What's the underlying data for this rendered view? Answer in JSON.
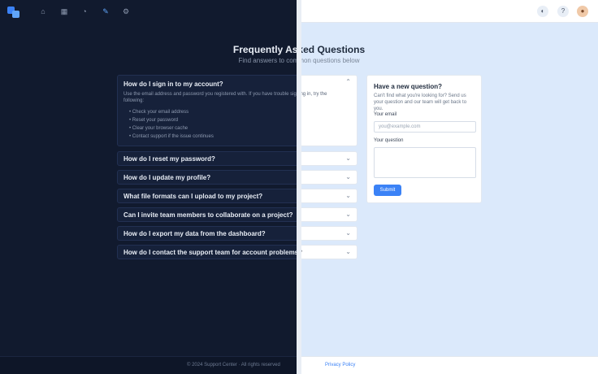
{
  "nav": {
    "icons": [
      "home-icon",
      "grid-icon",
      "bell-icon",
      "pencil-icon",
      "settings-icon"
    ]
  },
  "header_right": {
    "icons": [
      "theme-toggle-icon",
      "help-icon",
      "avatar"
    ]
  },
  "page": {
    "title": "Frequently Asked Questions",
    "subtitle": "Find answers to common questions below"
  },
  "faq": {
    "open_item": {
      "question": "How do I sign in to my account?",
      "answer": "Use the email address and password you registered with. If you have trouble signing in, try the following:",
      "bullets": [
        "Check your email address",
        "Reset your password",
        "Clear your browser cache",
        "Contact support if the issue continues"
      ]
    },
    "items": [
      "How do I reset my password?",
      "How do I update my profile?",
      "What file formats can I upload to my project?",
      "Can I invite team members to collaborate on a project?",
      "How do I export my data from the dashboard?",
      "How do I contact the support team for account problems?"
    ]
  },
  "ask": {
    "heading": "Have a new question?",
    "description": "Can't find what you're looking for? Send us your question and our team will get back to you.",
    "email_label": "Your email",
    "email_placeholder": "you@example.com",
    "question_label": "Your question",
    "submit_label": "Submit"
  },
  "footer": {
    "text": "© 2024 Support Center · All rights reserved",
    "link": "Privacy Policy"
  },
  "colors": {
    "dark_bg": "#111a2e",
    "light_bg": "#dbe9fb",
    "accent": "#3b82f6"
  }
}
